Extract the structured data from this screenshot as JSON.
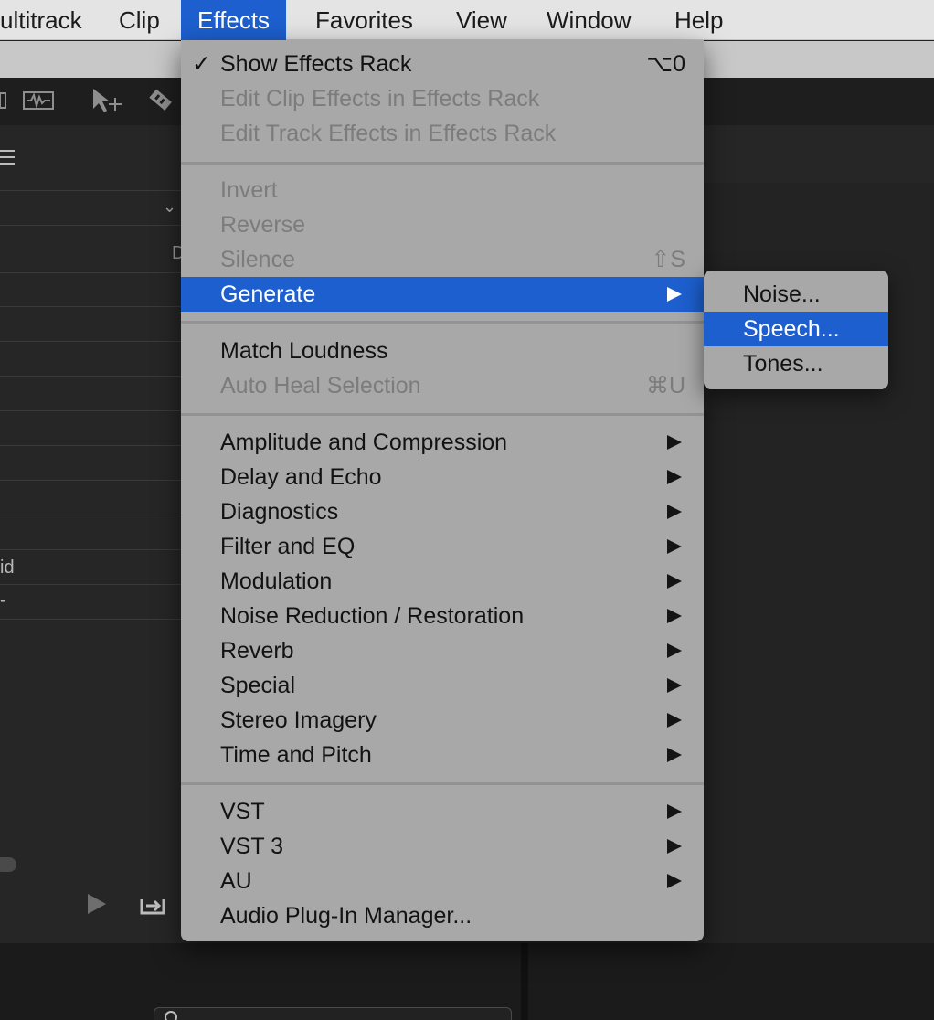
{
  "menubar": {
    "items": [
      "ultitrack",
      "Clip",
      "Effects",
      "Favorites",
      "View",
      "Window",
      "Help"
    ],
    "active": "Effects"
  },
  "left_panel": {
    "column_header": "D",
    "row_text_1": "id",
    "row_text_2": "-"
  },
  "effects_menu": {
    "show_effects_rack": {
      "label": "Show Effects Rack",
      "checked": true,
      "check": "✓",
      "shortcut": "⌥0"
    },
    "edit_clip_effects": {
      "label": "Edit Clip Effects in Effects Rack",
      "enabled": false
    },
    "edit_track_effects": {
      "label": "Edit Track Effects in Effects Rack",
      "enabled": false
    },
    "invert": {
      "label": "Invert",
      "enabled": false
    },
    "reverse": {
      "label": "Reverse",
      "enabled": false
    },
    "silence": {
      "label": "Silence",
      "enabled": false,
      "shortcut": "⇧S"
    },
    "generate": {
      "label": "Generate",
      "highlighted": true,
      "has_submenu": true
    },
    "match_loudness": {
      "label": "Match Loudness"
    },
    "auto_heal": {
      "label": "Auto Heal Selection",
      "enabled": false,
      "shortcut": "⌘U"
    },
    "groups": [
      "Amplitude and Compression",
      "Delay and Echo",
      "Diagnostics",
      "Filter and EQ",
      "Modulation",
      "Noise Reduction / Restoration",
      "Reverb",
      "Special",
      "Stereo Imagery",
      "Time and Pitch"
    ],
    "plugins": [
      "VST",
      "VST 3",
      "AU"
    ],
    "plugin_manager": {
      "label": "Audio Plug-In Manager..."
    }
  },
  "generate_submenu": {
    "items": [
      "Noise...",
      "Speech...",
      "Tones..."
    ],
    "highlighted": "Speech..."
  },
  "colors": {
    "highlight": "#1d5fce",
    "menu_background": "#a8a8a8",
    "app_background": "#232323"
  }
}
